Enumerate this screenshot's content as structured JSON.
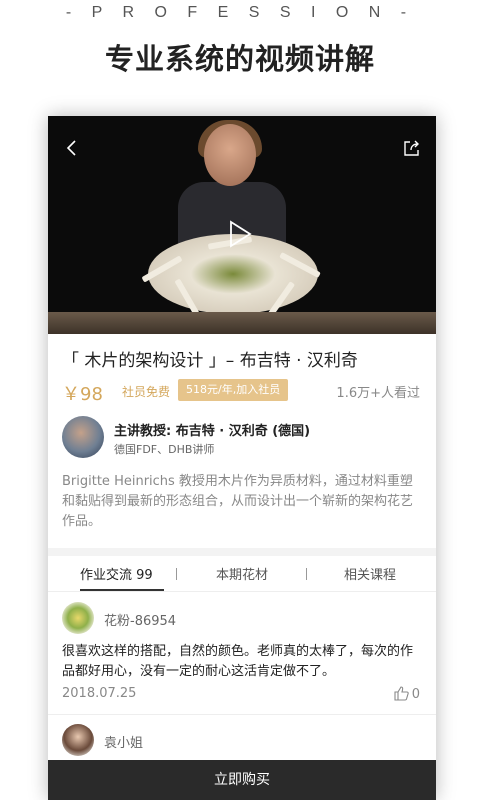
{
  "promo": {
    "tagline": "- P R O F E S S I O N -",
    "headline": "专业系统的视频讲解"
  },
  "course": {
    "title": "「 木片的架构设计 」– 布吉特 · 汉利奇",
    "price": "￥98",
    "member_free": "社员免费",
    "join_badge": "518元/年,加入社员",
    "viewers": "1.6万+人看过"
  },
  "instructor": {
    "name": "主讲教授: 布吉特 · 汉利奇 (德国)",
    "role": "德国FDF、DHB讲师"
  },
  "description": "Brigitte Heinrichs 教授用木片作为异质材料，通过材料重塑和黏贴得到最新的形态组合，从而设计出一个崭新的架构花艺作品。",
  "tabs": [
    {
      "label": "作业交流 99"
    },
    {
      "label": "本期花材"
    },
    {
      "label": "相关课程"
    }
  ],
  "comments": [
    {
      "user": "花粉-86954",
      "text": "很喜欢这样的搭配，自然的颜色。老师真的太棒了，每次的作品都好用心，没有一定的耐心这活肯定做不了。",
      "date": "2018.07.25",
      "likes": "0"
    },
    {
      "user": "袁小姐"
    }
  ],
  "actions": {
    "buy": "立即购买"
  },
  "colors": {
    "accent": "#d4a75c",
    "badge": "#e6c48b",
    "buy_bar": "#2a2a2a"
  }
}
